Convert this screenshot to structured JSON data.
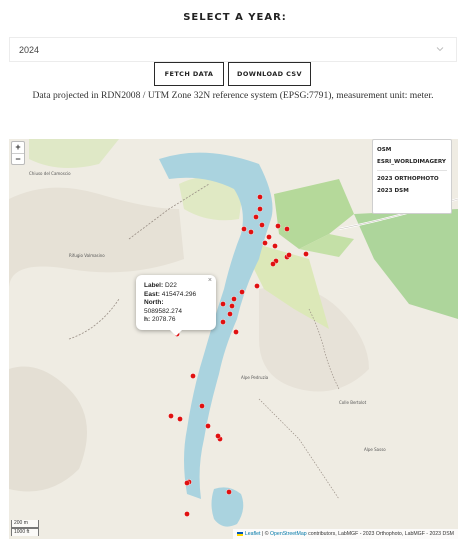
{
  "heading": "SELECT A YEAR:",
  "year_select": {
    "value": "2024"
  },
  "buttons": {
    "fetch": "FETCH DATA",
    "csv": "DOWNLOAD CSV"
  },
  "note": "Data projected in RDN2008 / UTM Zone 32N reference system (EPSG:7791), measurement unit: meter.",
  "map": {
    "zoom_in": "+",
    "zoom_out": "−",
    "layers": [
      "OSM",
      "ESRI_WORLDIMAGERY",
      "2023 ORTHOPHOTO",
      "2023 DSM"
    ],
    "popup": {
      "close": "×",
      "label_key": "Label:",
      "label_val": "D22",
      "east_key": "East:",
      "east_val": "415474.296",
      "north_key": "North:",
      "north_val": "5089582.274",
      "h_key": "h:",
      "h_val": "2078.76"
    },
    "scale": {
      "metric": "200 m",
      "imperial": "1000 ft"
    },
    "attribution": {
      "leaflet": "Leaflet",
      "sep": "|",
      "copy": "©",
      "osm": "OpenStreetMap",
      "rest": "contributors, LabMGF - 2023 Orthophoto, LabMGF - 2023 DSM"
    },
    "place_labels": [
      "Rifugio Valmasino",
      "Alpe Pedruzia",
      "Colle Bertolot",
      "Alpe Sasso",
      "Chiuso del Camoscio"
    ],
    "marker_color": "#e01010"
  }
}
